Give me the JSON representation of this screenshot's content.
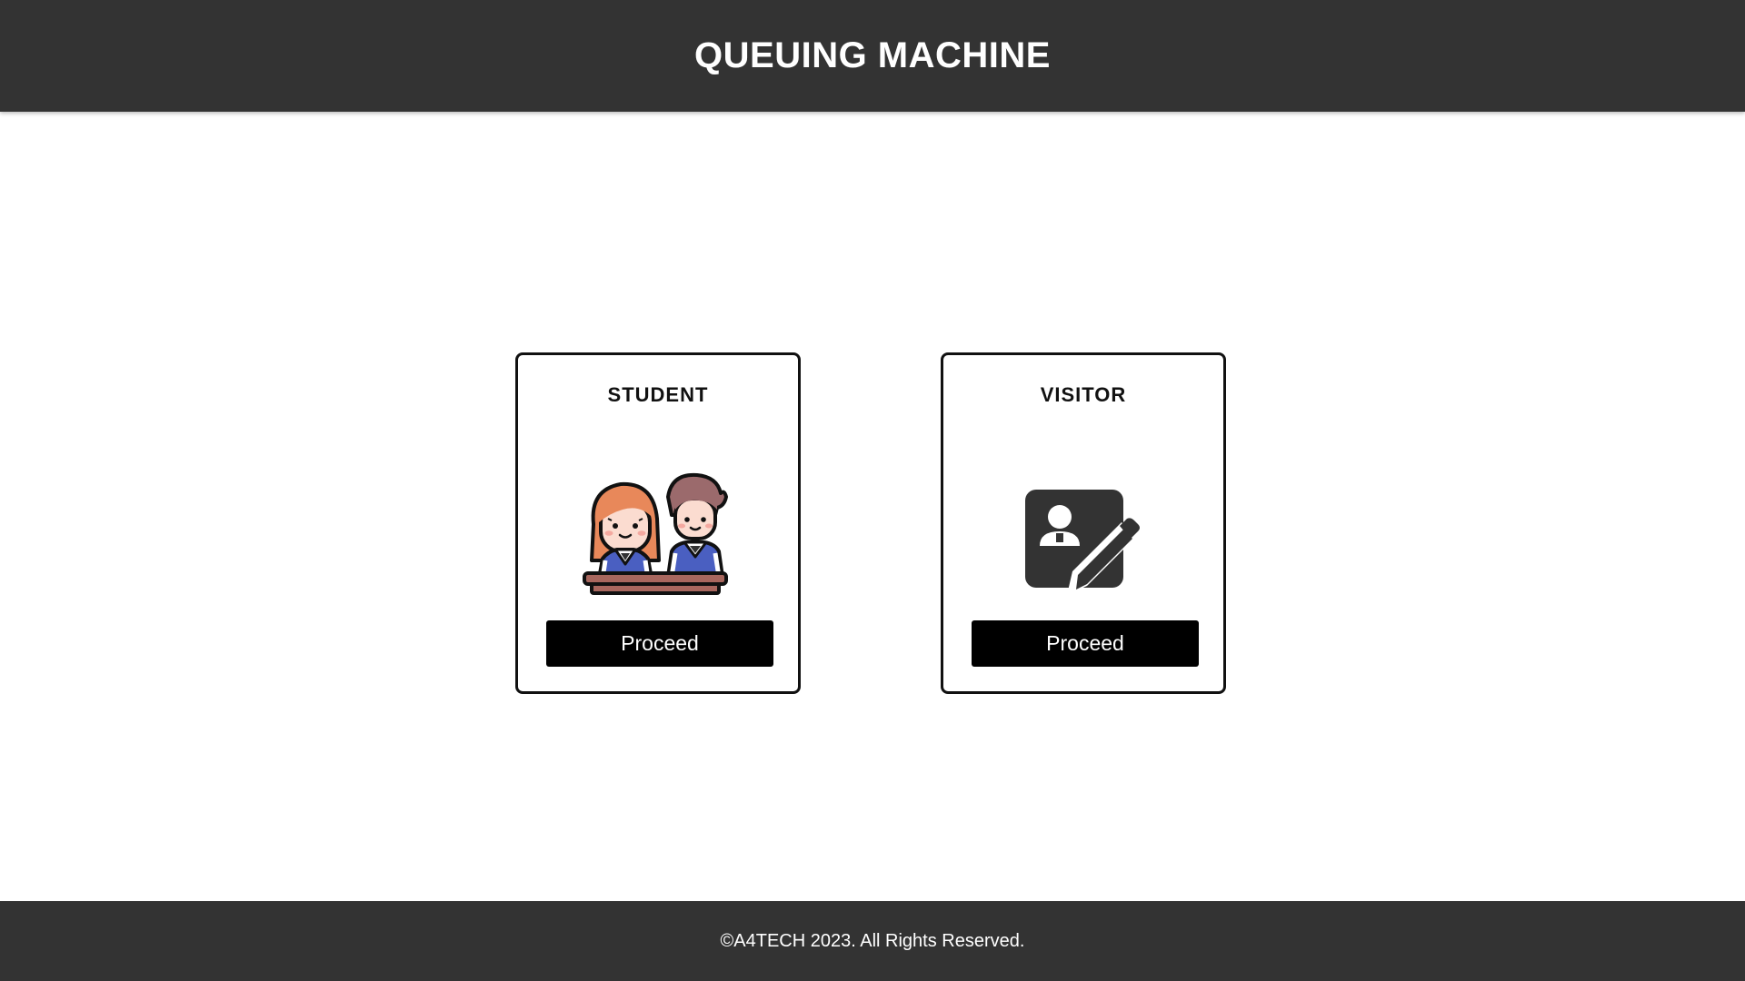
{
  "header": {
    "title": "QUEUING MACHINE"
  },
  "cards": [
    {
      "title": "STUDENT",
      "icon": "students-icon",
      "button_label": "Proceed"
    },
    {
      "title": "VISITOR",
      "icon": "visitor-registration-icon",
      "button_label": "Proceed"
    }
  ],
  "footer": {
    "copyright": "©A4TECH 2023. All Rights Reserved."
  },
  "colors": {
    "header_bg": "#333333",
    "footer_bg": "#333333",
    "button_bg": "#000000",
    "button_text": "#ffffff"
  }
}
